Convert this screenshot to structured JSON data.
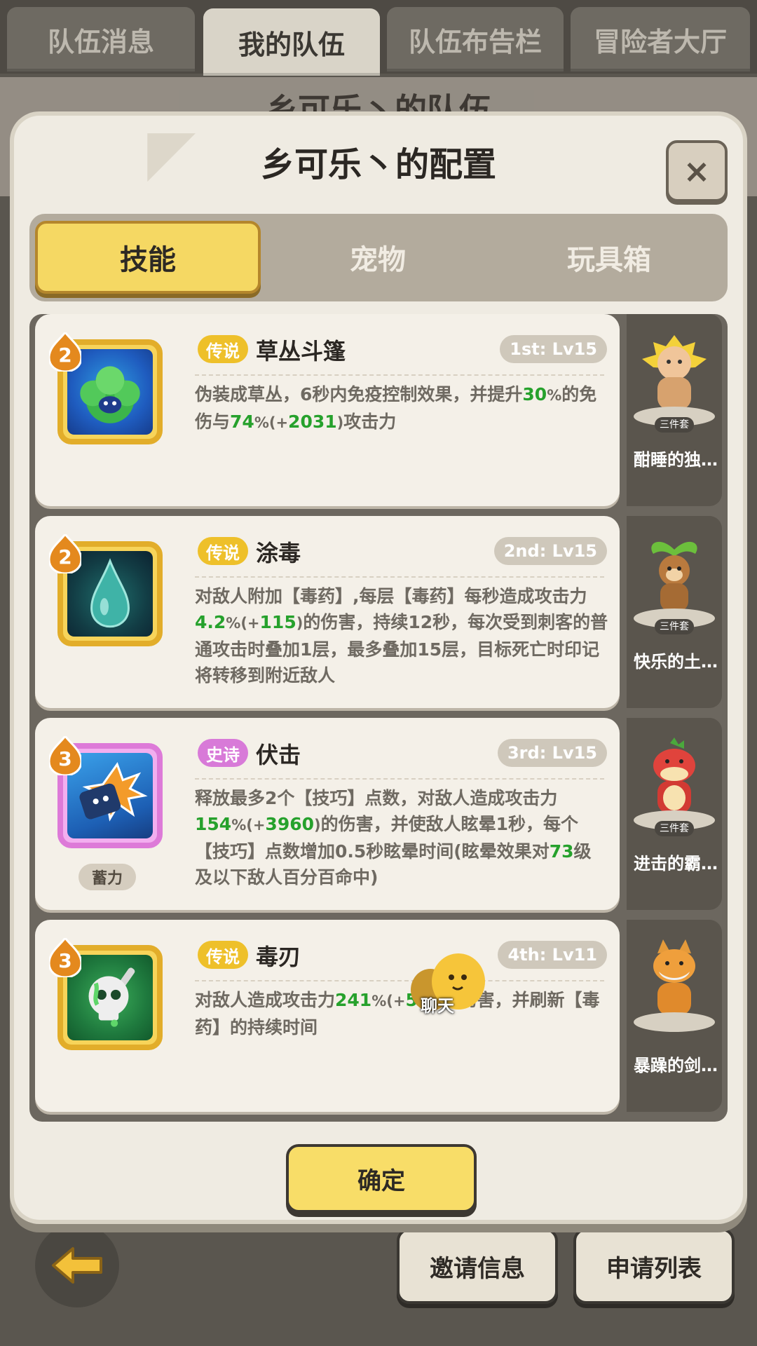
{
  "top_tabs": [
    "队伍消息",
    "我的队伍",
    "队伍布告栏",
    "冒险者大厅"
  ],
  "active_top_tab": "我的队伍",
  "background_title": "乡可乐丶的队伍",
  "dialog": {
    "title": "乡可乐丶的配置",
    "close_label": "×",
    "tabs": [
      "技能",
      "宠物",
      "玩具箱"
    ],
    "active_tab": "技能",
    "confirm_label": "确定"
  },
  "skills": [
    {
      "level": "2",
      "rarity": "传说",
      "name": "草丛斗篷",
      "slot": "1st: Lv15",
      "desc": "伪装成草丛，6秒内免疫控制效果，并提升30%的免伤与74%(+2031)攻击力",
      "pet_name": "酣睡的独…",
      "pet_tag": "三件套"
    },
    {
      "level": "2",
      "rarity": "传说",
      "name": "涂毒",
      "slot": "2nd: Lv15",
      "desc": "对敌人附加【毒药】,每层【毒药】每秒造成攻击力4.2%(+115)的伤害，持续12秒，每次受到刺客的普通攻击时叠加1层，最多叠加15层，目标死亡时印记将转移到附近敌人",
      "pet_name": "快乐的土…",
      "pet_tag": "三件套"
    },
    {
      "level": "3",
      "rarity": "史诗",
      "name": "伏击",
      "slot": "3rd: Lv15",
      "charge_tag": "蓄力",
      "desc": "释放最多2个【技巧】点数，对敌人造成攻击力154%(+3960)的伤害，并使敌人眩晕1秒，每个【技巧】点数增加0.5秒眩晕时间(眩晕效果对73级及以下敌人百分百命中)",
      "pet_name": "进击的霸…",
      "pet_tag": "三件套"
    },
    {
      "level": "3",
      "rarity": "传说",
      "name": "毒刃",
      "slot": "4th: Lv11",
      "desc": "对敌人造成攻击力241%(+5…)的伤害，并刷新【毒药】的持续时间",
      "pet_name": "暴躁的剑…",
      "pet_tag": ""
    }
  ],
  "chat_label": "聊天",
  "bottom_buttons": [
    "邀请信息",
    "申请列表"
  ],
  "colors": {
    "legend": "#eec02a",
    "epic": "#d87ad8",
    "highlight_green": "#26a12c",
    "confirm_yellow": "#f8dd68"
  }
}
